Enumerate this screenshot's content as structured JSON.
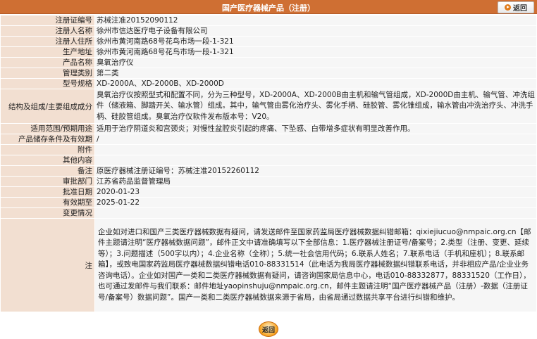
{
  "header": {
    "title": "国产医疗器械产品（注册）",
    "back_label": "返回"
  },
  "rows": [
    {
      "label": "注册证编号",
      "value": "苏械注准20152090112"
    },
    {
      "label": "注册人名称",
      "value": "徐州市信达医疗电子设备有限公司"
    },
    {
      "label": "注册人住所",
      "value": "徐州市黄河南路68号花鸟市场一段-1-321"
    },
    {
      "label": "生产地址",
      "value": "徐州市黄河南路68号花鸟市场一段-1-321"
    },
    {
      "label": "产品名称",
      "value": "臭氧治疗仪"
    },
    {
      "label": "管理类别",
      "value": "第二类"
    },
    {
      "label": "型号规格",
      "value": "XD-2000A、XD-2000B、XD-2000D"
    },
    {
      "label": "结构及组成/主要组成成分",
      "value": "臭氧治疗仪按照型式和配置不同，分为三种型号，XD-2000A、XD-2000B由主机和输气管组成，XD-2000D由主机、输气管、冲洗组件（储液箱、脚踏开关、输水管）组成。其中，输气管由雾化治疗头、雾化手柄、硅胶管、雾化锥组成，输水管由冲洗治疗头、冲洗手柄、硅胶管组成。臭氧治疗仪软件发布版本号：V20。"
    },
    {
      "label": "适用范围/预期用途",
      "value": "适用于治疗阴道炎和宫颈炎；对慢性盆腔炎引起的疼痛、下坠感、白带增多症状有明显改善作用。"
    },
    {
      "label": "产品储存条件及有效期",
      "value": "/"
    },
    {
      "label": "附件",
      "value": ""
    },
    {
      "label": "其他内容",
      "value": ""
    },
    {
      "label": "备注",
      "value": "原医疗器械注册证编号：苏械注准20152260112"
    },
    {
      "label": "审批部门",
      "value": "江苏省药品监督管理局"
    },
    {
      "label": "批准日期",
      "value": "2020-01-23"
    },
    {
      "label": "有效期至",
      "value": "2025-01-22"
    },
    {
      "label": "变更情况",
      "value": ""
    }
  ],
  "note": {
    "label": "注",
    "text": "企业如对进口和国产三类医疗器械数据有疑问，请发送邮件至国家药监局医疗器械数据纠错邮箱：qixiejiucuo@nmpaic.org.cn【邮件主题请注明“医疗器械数据问题”，邮件正文中请准确填写以下全部信息：1.医疗器械注册证号/备案号；2.类型（注册、变更、延续等）；3.问题描述（500字以内）；4.企业名称（全称）；5.统一社会信用代码；6.联系人姓名；7.联系电话（手机和座机）；8.联系邮箱】，或致电国家药监局医疗器械数据纠错电话010-88331514（此电话为我局医疗器械数据纠错联系电话，并非相应产品/企业业务咨询电话）。企业如对国产一类和二类医疗器械数据有疑问，请咨询国家局信息中心，电话010-88332877，88331520（工作日），也可通过发邮件与我们联系：邮件地址yaopinshuju@nmpaic.org.cn，邮件主题请注明“国产医疗器械产品（注册）-数据（注册证号/备案号）数据问题”。国产一类和二类医疗器械数据来源于省局，由省局通过数据共享平台进行纠错和维护。"
  },
  "footer": {
    "back_label": "返回"
  }
}
